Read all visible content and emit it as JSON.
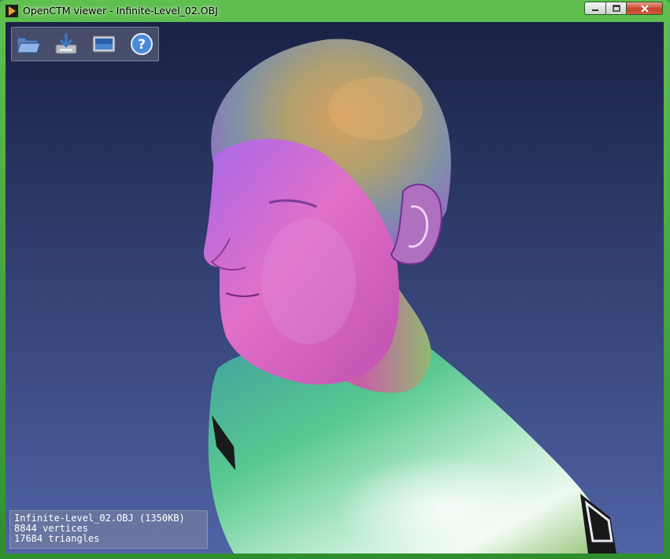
{
  "window": {
    "title": "OpenCTM viewer - Infinite-Level_02.OBJ",
    "controls": {
      "minimize": "minimize",
      "maximize": "maximize",
      "close": "close"
    }
  },
  "toolbar": {
    "buttons": [
      {
        "name": "open-file-icon"
      },
      {
        "name": "save-file-icon"
      },
      {
        "name": "screenshot-icon"
      },
      {
        "name": "help-icon"
      }
    ]
  },
  "info": {
    "file_line": "Infinite-Level_02.OBJ (1350KB)",
    "vertices_line": "8844 vertices",
    "triangles_line": "17684 triangles"
  },
  "colors": {
    "frame_accent": "#3a9a3a",
    "viewport_top": "#1a2146",
    "viewport_bottom": "#4f63a6"
  }
}
